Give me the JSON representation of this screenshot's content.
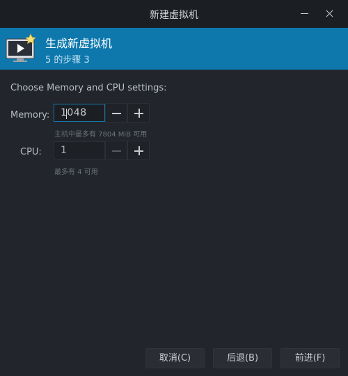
{
  "window": {
    "title": "新建虚拟机"
  },
  "header": {
    "title": "生成新虚拟机",
    "subtitle": "5 的步骤 3"
  },
  "main": {
    "prompt": "Choose Memory and CPU settings:",
    "memory": {
      "label": "Memory:",
      "value": "1048",
      "hint": "主机中最多有 7804 MiB 可用"
    },
    "cpu": {
      "label": "CPU:",
      "value": "1",
      "hint": "最多有 4 可用"
    }
  },
  "footer": {
    "cancel_label": "取消(C)",
    "back_label": "后退(B)",
    "forward_label": "前进(F)"
  },
  "colors": {
    "header_bg": "#0e78ad",
    "window_bg": "#22262c",
    "titlebar_bg": "#1b1e22"
  }
}
